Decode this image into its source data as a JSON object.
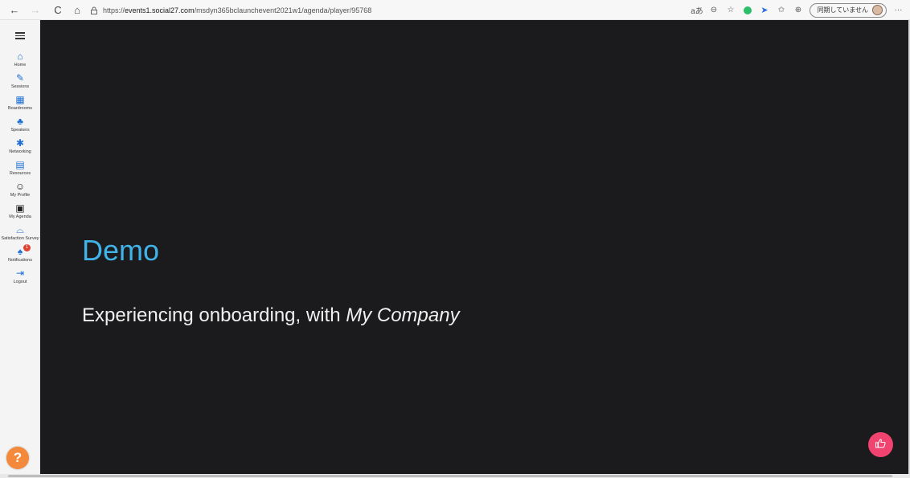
{
  "browser": {
    "back_icon": "←",
    "forward_icon": "→",
    "reload_icon": "C",
    "home_icon": "⌂",
    "url_prefix": "https://",
    "url_host": "events1.social27.com",
    "url_path": "/msdyn365bclaunchevent2021w1/agenda/player/95768",
    "read_aloud_icon": "aあ",
    "zoom_icon": "⊖",
    "favorite_icon": "☆",
    "collections_icon": "✩",
    "ext_icon": "⊕",
    "sync_label": "同期していません",
    "more_icon": "···"
  },
  "sidebar": {
    "items": [
      {
        "label": "Home",
        "icon": "home-icon",
        "glyph": "⌂"
      },
      {
        "label": "Sessions",
        "icon": "pencil-icon",
        "glyph": "✎"
      },
      {
        "label": "Boardrooms",
        "icon": "boardroom-icon",
        "glyph": "▦"
      },
      {
        "label": "Speakers",
        "icon": "speaker-icon",
        "glyph": "♣"
      },
      {
        "label": "Networking",
        "icon": "networking-icon",
        "glyph": "✱"
      },
      {
        "label": "Resources",
        "icon": "resources-icon",
        "glyph": "▤"
      },
      {
        "label": "My Profile",
        "icon": "profile-icon",
        "glyph": "☺"
      },
      {
        "label": "My Agenda",
        "icon": "calendar-icon",
        "glyph": "▣"
      },
      {
        "label": "Satisfaction Survey",
        "icon": "survey-icon",
        "glyph": "⌓"
      },
      {
        "label": "Notifications",
        "icon": "bell-icon",
        "glyph": "♠",
        "badge": "1"
      },
      {
        "label": "Logout",
        "icon": "logout-icon",
        "glyph": "⇥"
      }
    ],
    "help_label": "?"
  },
  "player": {
    "title": "Demo",
    "subtitle_text": "Experiencing onboarding, with ",
    "subtitle_company": "My Company",
    "like_icon": "👍"
  },
  "colors": {
    "accent": "#41b3e8",
    "player_bg": "#1b1b1d",
    "like_button": "#f04370",
    "help_button": "#f5893b",
    "nav_icon": "#1f6fd1",
    "badge": "#e0402f"
  }
}
